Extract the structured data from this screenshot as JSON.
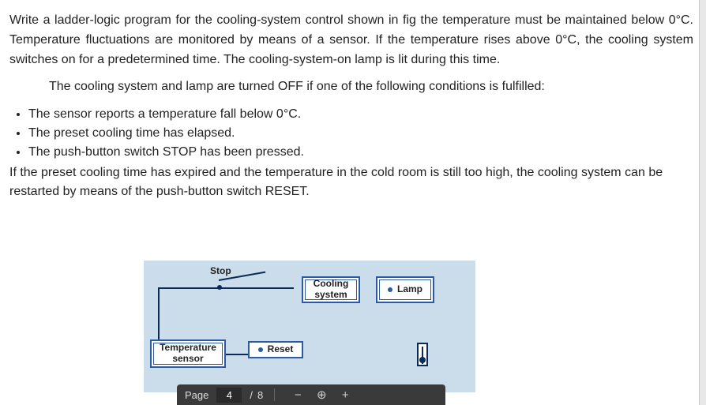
{
  "document": {
    "p1": "Write a ladder-logic program for the cooling-system control shown in fig the temperature must be maintained below 0°C. Temperature fluctuations are monitored by means of a sensor. If the temperature rises above 0°C, the cooling system switches on for a predetermined time. The cooling-system-on lamp is lit during this time.",
    "p2": "The cooling system and lamp are turned OFF if one of the following conditions is fulfilled:",
    "bullets": [
      "The sensor reports a temperature fall below 0°C.",
      "The preset cooling time has elapsed.",
      "The push-button switch STOP has been pressed."
    ],
    "p3": "If the preset cooling time has expired and the temperature in the cold room is still too high, the cooling system can be restarted by means of the push-button switch RESET."
  },
  "diagram": {
    "stop_label": "Stop",
    "sensor_label": "Temperature\nsensor",
    "reset_label": "Reset",
    "cooling_label": "Cooling\nsystem",
    "lamp_label": "Lamp"
  },
  "viewer": {
    "page_label": "Page",
    "current_page": "4",
    "page_sep": "/",
    "total_pages": "8",
    "zoom_out": "−",
    "auto_zoom_icon": "⊕",
    "zoom_in": "+"
  }
}
